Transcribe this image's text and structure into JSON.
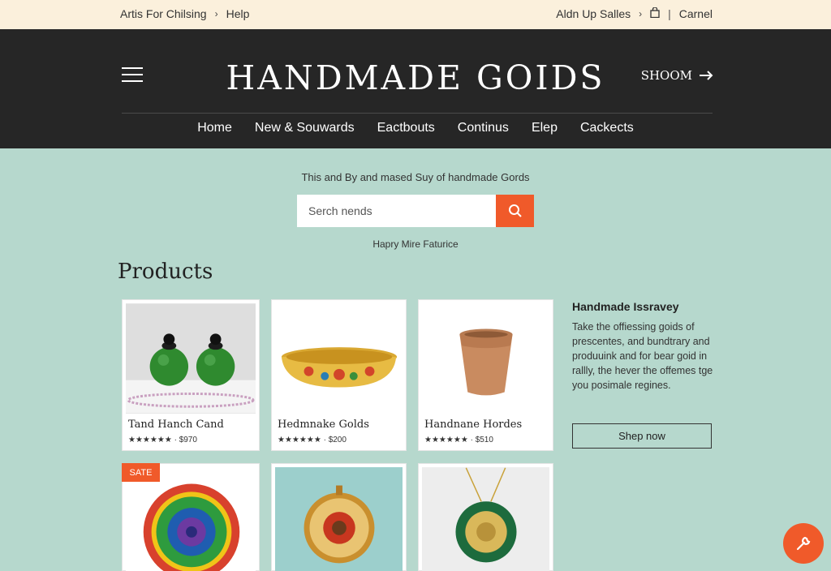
{
  "topbar": {
    "left_link": "Artis For Chilsing",
    "help": "Help",
    "right_link": "Aldn Up Salles",
    "account": "Carnel"
  },
  "header": {
    "brand": "HANDMADE GOIDS",
    "shop_label": "SHOOM",
    "nav": [
      "Home",
      "New & Souwards",
      "Eactbouts",
      "Continus",
      "Elep",
      "Cackects"
    ]
  },
  "hero": {
    "tagline": "This and By and mased Suy of handmade Gords",
    "search_placeholder": "Serch nends",
    "subtag": "Hapry Mire Faturice"
  },
  "products": {
    "title": "Products",
    "items": [
      {
        "name": "Tand Hanch Cand",
        "rating": "★★★★★★",
        "price": "$970"
      },
      {
        "name": "Hedmnake Golds",
        "rating": "★★★★★★",
        "price": "$200"
      },
      {
        "name": "Handnane Hordes",
        "rating": "★★★★★★",
        "price": "$510"
      }
    ],
    "sale_badge": "SATE"
  },
  "promo": {
    "title": "Handmade Issravey",
    "text": "Take the offiessing goids of prescentes, and bundtrary and produuink and for bear goid in rallly, the hever the offemes tge you posimale regines.",
    "button": "Shep now"
  },
  "colors": {
    "accent": "#f05a2a",
    "header_bg": "#262626",
    "page_bg": "#b6d8cd",
    "topbar_bg": "#fbf0dc"
  }
}
